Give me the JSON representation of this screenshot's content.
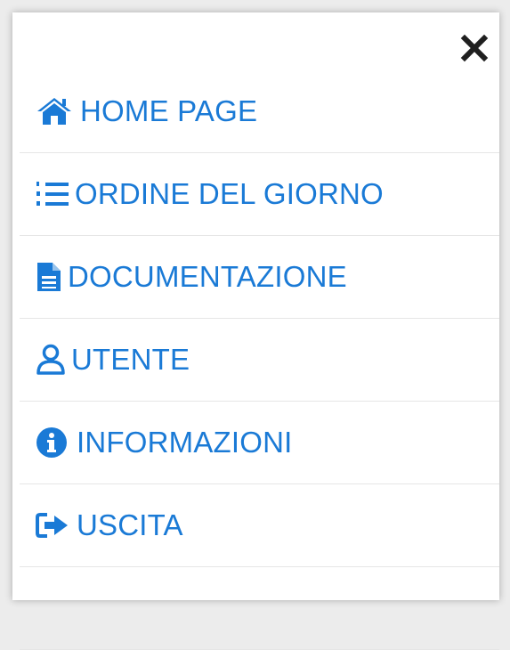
{
  "colors": {
    "accent": "#1a7ad6",
    "close": "#1f1f1f",
    "divider": "#e6e6e6"
  },
  "close_button": {
    "icon": "close-icon"
  },
  "menu": {
    "items": [
      {
        "label": "HOME PAGE",
        "icon": "home-icon"
      },
      {
        "label": "ORDINE DEL GIORNO",
        "icon": "ordered-list-icon"
      },
      {
        "label": "DOCUMENTAZIONE",
        "icon": "document-icon"
      },
      {
        "label": "UTENTE",
        "icon": "user-icon"
      },
      {
        "label": "INFORMAZIONI",
        "icon": "info-icon"
      },
      {
        "label": "USCITA",
        "icon": "sign-out-icon"
      }
    ]
  }
}
